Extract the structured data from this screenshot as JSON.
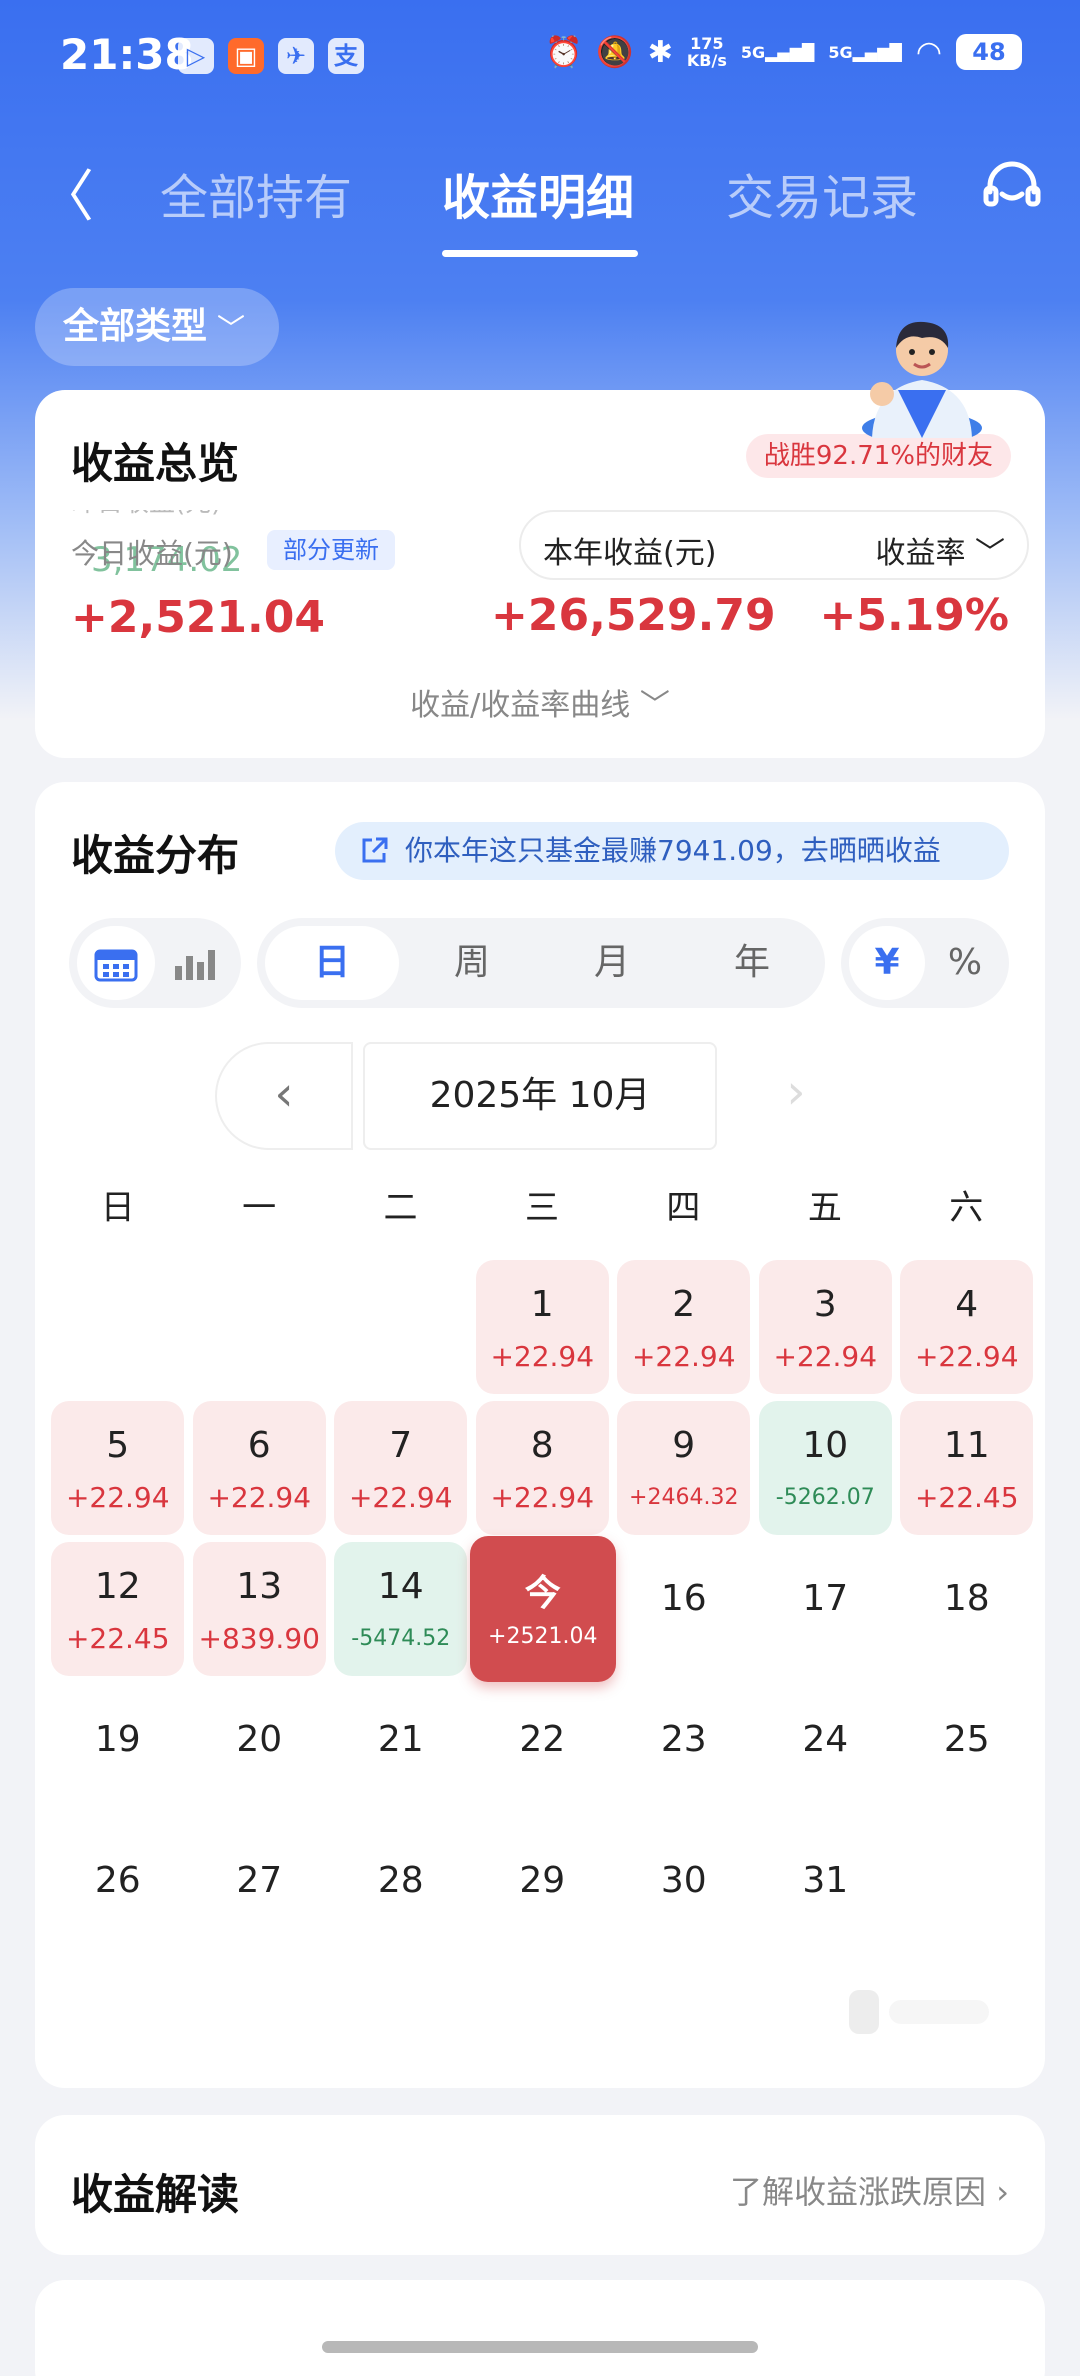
{
  "status_bar": {
    "time": "21:38",
    "app_icons": [
      "play-icon",
      "store-icon",
      "bird-icon",
      "alipay-icon"
    ],
    "net_speed_value": "175",
    "net_speed_unit": "KB/s",
    "signal1": "5G",
    "signal2": "5G",
    "battery": "48"
  },
  "nav": {
    "tabs": [
      {
        "label": "全部持有",
        "active": false
      },
      {
        "label": "收益明细",
        "active": true
      },
      {
        "label": "交易记录",
        "active": false
      }
    ]
  },
  "filter": {
    "label": "全部类型"
  },
  "overview": {
    "title": "收益总览",
    "beat_badge": "战胜92.71%的财友",
    "ghost_prev": "昨日收益(元)",
    "ghost_value": "3,174.02",
    "today_label": "今日收益(元)",
    "partial_badge": "部分更新",
    "today_value": "+2,521.04",
    "year_label": "本年收益(元)",
    "rate_label": "收益率",
    "year_value": "+26,529.79",
    "rate_value": "+5.19%",
    "curve_link": "收益/收益率曲线"
  },
  "distribution": {
    "title": "收益分布",
    "promo": "你本年这只基金最赚7941.09，去晒晒收益",
    "periods": [
      "日",
      "周",
      "月",
      "年"
    ],
    "active_period": "日",
    "units": [
      "¥",
      "%"
    ],
    "active_unit": "¥",
    "month_label": "2025年 10月",
    "weekdays": [
      "日",
      "一",
      "二",
      "三",
      "四",
      "五",
      "六"
    ],
    "days": [
      {
        "day": "1",
        "value": "+22.94",
        "type": "pos"
      },
      {
        "day": "2",
        "value": "+22.94",
        "type": "pos"
      },
      {
        "day": "3",
        "value": "+22.94",
        "type": "pos"
      },
      {
        "day": "4",
        "value": "+22.94",
        "type": "pos"
      },
      {
        "day": "5",
        "value": "+22.94",
        "type": "pos"
      },
      {
        "day": "6",
        "value": "+22.94",
        "type": "pos"
      },
      {
        "day": "7",
        "value": "+22.94",
        "type": "pos"
      },
      {
        "day": "8",
        "value": "+22.94",
        "type": "pos"
      },
      {
        "day": "9",
        "value": "+2464.32",
        "type": "pos"
      },
      {
        "day": "10",
        "value": "-5262.07",
        "type": "neg"
      },
      {
        "day": "11",
        "value": "+22.45",
        "type": "pos"
      },
      {
        "day": "12",
        "value": "+22.45",
        "type": "pos"
      },
      {
        "day": "13",
        "value": "+839.90",
        "type": "pos"
      },
      {
        "day": "14",
        "value": "-5474.52",
        "type": "neg"
      },
      {
        "day": "今",
        "value": "+2521.04",
        "type": "today"
      },
      {
        "day": "16",
        "value": "",
        "type": "plain"
      },
      {
        "day": "17",
        "value": "",
        "type": "plain"
      },
      {
        "day": "18",
        "value": "",
        "type": "plain"
      },
      {
        "day": "19",
        "value": "",
        "type": "plain"
      },
      {
        "day": "20",
        "value": "",
        "type": "plain"
      },
      {
        "day": "21",
        "value": "",
        "type": "plain"
      },
      {
        "day": "22",
        "value": "",
        "type": "plain"
      },
      {
        "day": "23",
        "value": "",
        "type": "plain"
      },
      {
        "day": "24",
        "value": "",
        "type": "plain"
      },
      {
        "day": "25",
        "value": "",
        "type": "plain"
      },
      {
        "day": "26",
        "value": "",
        "type": "plain"
      },
      {
        "day": "27",
        "value": "",
        "type": "plain"
      },
      {
        "day": "28",
        "value": "",
        "type": "plain"
      },
      {
        "day": "29",
        "value": "",
        "type": "plain"
      },
      {
        "day": "30",
        "value": "",
        "type": "plain"
      },
      {
        "day": "31",
        "value": "",
        "type": "plain"
      }
    ],
    "first_weekday_index": 3
  },
  "interpretation": {
    "title": "收益解读",
    "link": "了解收益涨跌原因"
  },
  "colors": {
    "brand_blue": "#3a6ff0",
    "gain_red": "#d9363e",
    "loss_green": "#2e8b57",
    "today_red": "#d14c4f"
  }
}
